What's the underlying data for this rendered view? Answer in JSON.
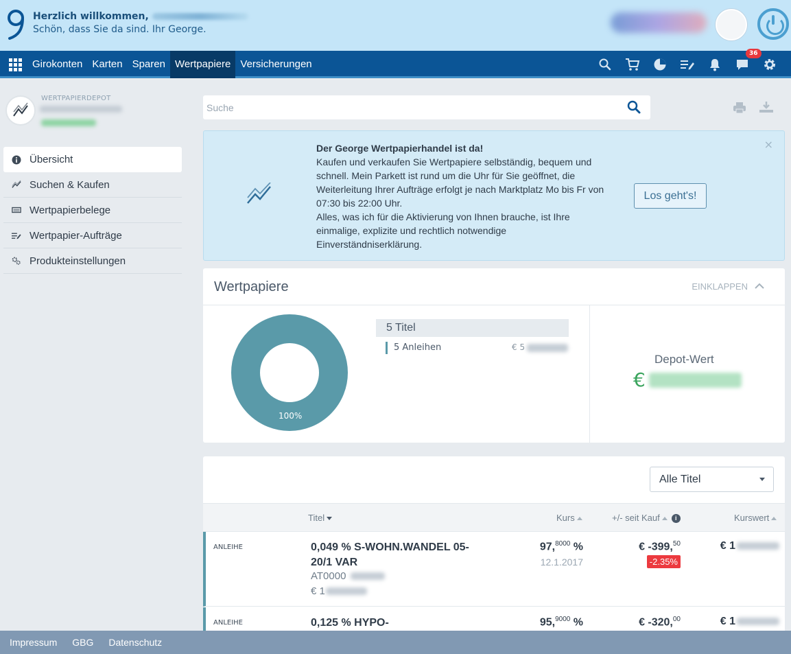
{
  "header": {
    "welcome_title": "Herzlich willkommen,",
    "welcome_subtitle": "Schön, dass Sie da sind. Ihr George."
  },
  "nav": {
    "items": [
      {
        "label": "Girokonten"
      },
      {
        "label": "Karten"
      },
      {
        "label": "Sparen"
      },
      {
        "label": "Wertpapiere"
      },
      {
        "label": "Versicherungen"
      }
    ],
    "active": "Wertpapiere",
    "icons": [
      "search-icon",
      "cart-icon",
      "chart-pie-icon",
      "list-edit-icon",
      "bell-icon",
      "chat-icon",
      "gear-icon"
    ],
    "chat_badge": "36"
  },
  "sidebar": {
    "account_label": "WERTPAPIERDEPOT",
    "menu": [
      {
        "label": "Übersicht",
        "icon": "info-icon"
      },
      {
        "label": "Suchen & Kaufen",
        "icon": "trend-icon"
      },
      {
        "label": "Wertpapierbelege",
        "icon": "receipt-icon"
      },
      {
        "label": "Wertpapier-Aufträge",
        "icon": "list-edit-icon"
      },
      {
        "label": "Produkteinstellungen",
        "icon": "cogs-icon"
      }
    ]
  },
  "search": {
    "placeholder": "Suche"
  },
  "banner": {
    "title": "Der George Wertpapierhandel ist da!",
    "body": "Kaufen und verkaufen Sie Wertpapiere selbständig, bequem und schnell. Mein Parkett ist rund um die Uhr für Sie geöffnet, die Weiterleitung Ihrer Aufträge erfolgt je nach Marktplatz Mo bis Fr von 07:30 bis 22:00 Uhr.",
    "body2": "Alles, was ich für die Aktivierung von Ihnen brauche, ist Ihre einmalige, explizite und rechtlich notwendige Einverständniserklärung.",
    "cta": "Los geht's!",
    "close": "×"
  },
  "portfolio": {
    "title": "Wertpapiere",
    "collapse_label": "EINKLAPPEN",
    "donut_percent_label": "100%",
    "donut_share": 1.0,
    "donut_color": "#5a9aa9",
    "titles_head": "5 Titel",
    "titles_row": "5 Anleihen",
    "titles_amount_prefix": "€ 5",
    "depot_label": "Depot-Wert",
    "depot_currency": "€"
  },
  "table": {
    "filter_value": "Alle Titel",
    "headers": {
      "titel": "Titel",
      "kurs": "Kurs",
      "pl": "+/- seit Kauf",
      "kurswert": "Kurswert"
    },
    "rows": [
      {
        "type": "ANLEIHE",
        "name": "0,049 % S-WOHN.WANDEL 05-20/1 VAR",
        "isin": "AT0000",
        "amount": "€ 1",
        "kurs_main": "97,",
        "kurs_sup": "8000",
        "kurs_unit": " %",
        "kurs_date": "12.1.2017",
        "pl_main": "€ -399,",
        "pl_sup": "50",
        "pct": "-2.35%",
        "kurswert": "€ 1"
      },
      {
        "type": "ANLEIHE",
        "name": "0,125 % HYPO-",
        "isin": "",
        "amount": "",
        "kurs_main": "95,",
        "kurs_sup": "9000",
        "kurs_unit": " %",
        "kurs_date": "",
        "pl_main": "€ -320,",
        "pl_sup": "00",
        "pct": "",
        "kurswert": "€ 1"
      }
    ]
  },
  "footer": {
    "links": [
      "Impressum",
      "GBG",
      "Datenschutz"
    ]
  }
}
